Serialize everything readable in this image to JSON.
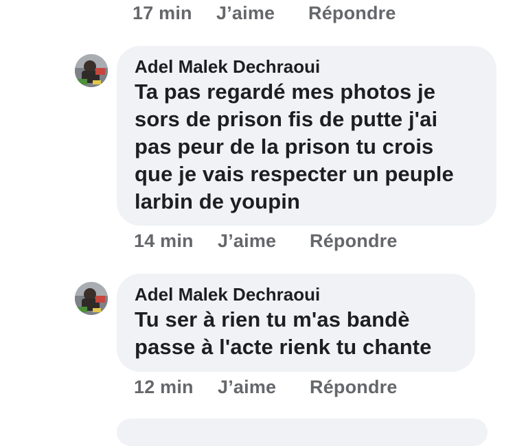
{
  "top_actions": {
    "time": "17 min",
    "like": "J’aime",
    "reply": "Répondre"
  },
  "comments": [
    {
      "author": "Adel Malek Dechraoui",
      "text": "Ta pas regardé mes photos je\nsors de prison fis de putte j'ai\npas peur de la prison tu crois\nque je vais respecter un peuple\nlarbin de youpin",
      "time": "14 min",
      "like": "J’aime",
      "reply": "Répondre"
    },
    {
      "author": "Adel Malek Dechraoui",
      "text": "Tu ser à rien tu m'as bandè\npasse à l'acte rienk tu chante",
      "time": "12 min",
      "like": "J’aime",
      "reply": "Répondre"
    }
  ],
  "colors": {
    "bubble": "#f0f2f5",
    "meta_text": "#65676b",
    "body_text": "#1c1e21"
  }
}
